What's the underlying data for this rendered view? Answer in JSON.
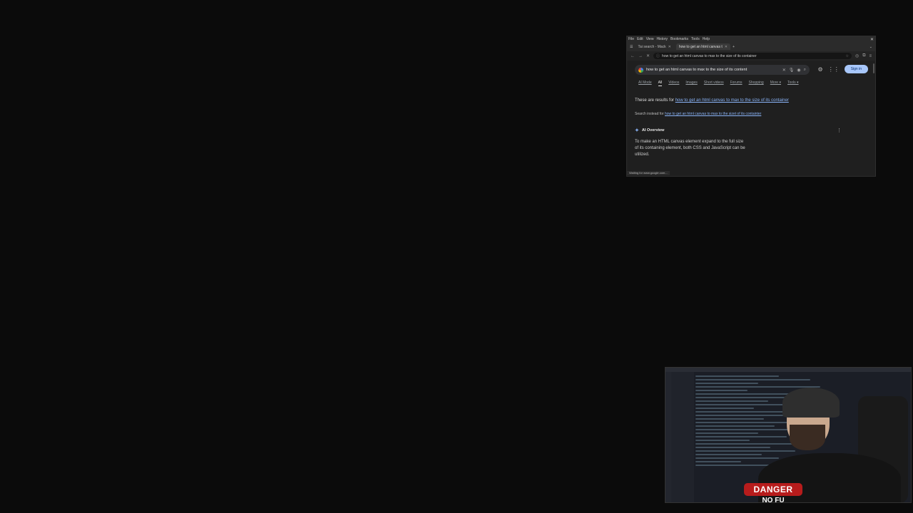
{
  "browser": {
    "menubar": [
      "File",
      "Edit",
      "View",
      "History",
      "Bookmarks",
      "Tools",
      "Help"
    ],
    "tabs": [
      {
        "label": "Tai search - Mack"
      },
      {
        "label": "how to get an html canvas t"
      }
    ],
    "url": "how to get an html canvas to max to the size of its container",
    "search": {
      "query": "how to get an html canvas to max to the size of its content",
      "sign_in": "Sign in"
    },
    "filters": [
      "AI Mode",
      "All",
      "Videos",
      "Images",
      "Short videos",
      "Forums",
      "Shopping",
      "More ▾",
      "Tools ▾"
    ],
    "results_for_prefix": "These are results for",
    "results_for_link": "how to get an html canvas to max to the size of its container",
    "search_instead_prefix": "Search instead for",
    "search_instead_link": "how to get an html canvas to max to the sizet of its containter",
    "ai_overview": {
      "heading": "AI Overview",
      "text": "To make an HTML canvas element expand to the full size of its containing element, both CSS and JavaScript can be utilized."
    },
    "status": "Waiting for www.google.com..."
  },
  "webcam": {
    "shirt_text": "DANGER",
    "shirt_sub": "NO FU"
  },
  "colors": {
    "link": "#8ab4f8",
    "signin_bg": "#a8c7fa",
    "danger": "#b71c1c"
  }
}
